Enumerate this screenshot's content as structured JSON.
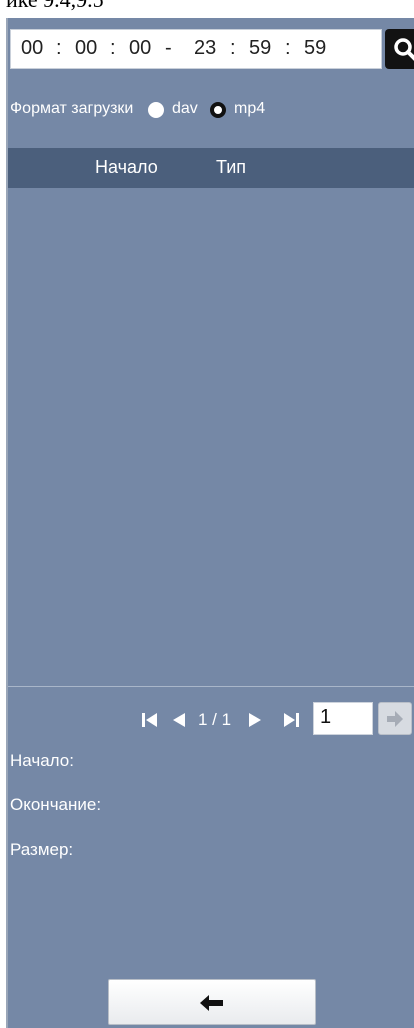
{
  "top_fragment": "ике 9.4,9.5",
  "time_range": {
    "start_h": "00",
    "start_m": "00",
    "start_s": "00",
    "separator": "-",
    "end_h": "23",
    "end_m": "59",
    "end_s": "59",
    "colon": ":"
  },
  "search_button": {
    "icon": "search-icon"
  },
  "download_format": {
    "label": "Формат загрузки",
    "options": [
      {
        "label": "dav",
        "selected": false
      },
      {
        "label": "mp4",
        "selected": true
      }
    ]
  },
  "table": {
    "columns": [
      "Начало",
      "Тип"
    ],
    "rows": []
  },
  "pager": {
    "current_page": 1,
    "total_pages": 1,
    "page_display": "1 / 1",
    "page_input_value": "1"
  },
  "info": {
    "start_label": "Начало:",
    "end_label": "Окончание:",
    "size_label": "Размер:"
  },
  "back_button": {
    "icon": "arrow-left-icon"
  },
  "colors": {
    "panel": "#7588a6",
    "header": "#4b5f7c"
  }
}
